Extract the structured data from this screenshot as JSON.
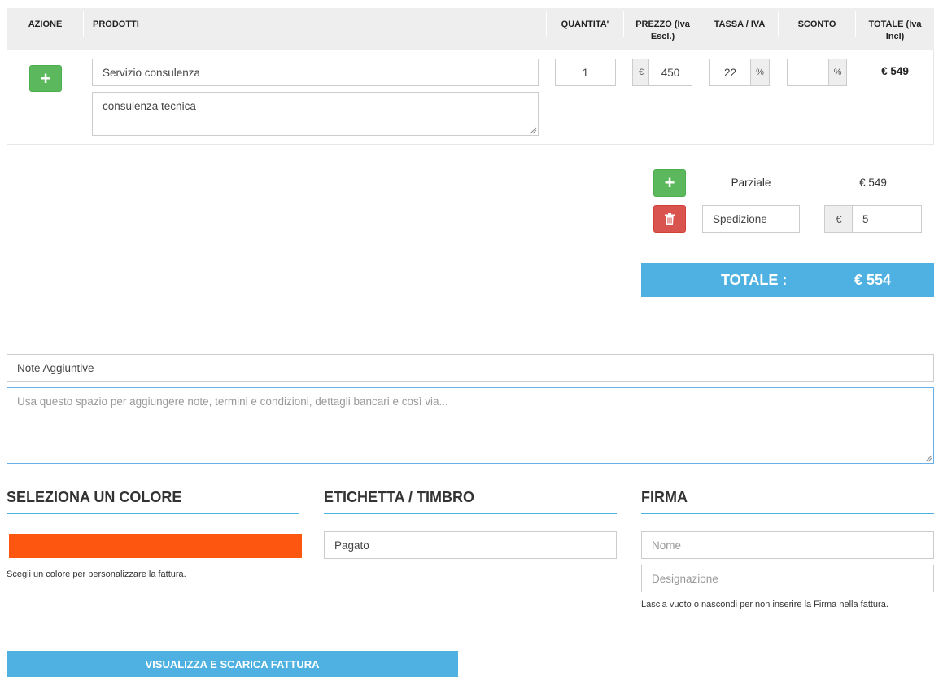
{
  "table": {
    "headers": {
      "azione": "AZIONE",
      "prodotti": "PRODOTTI",
      "quantita": "QUANTITA'",
      "prezzo_line1": "PREZZO (Iva",
      "prezzo_line2": "Escl.)",
      "tassa": "TASSA / IVA",
      "sconto": "SCONTO",
      "totale_line1": "TOTALE (Iva",
      "totale_line2": "Incl)"
    },
    "row": {
      "product_name": "Servizio consulenza",
      "description": "consulenza tecnica",
      "quantity": "1",
      "price_currency": "€",
      "price": "450",
      "tax": "22",
      "tax_unit": "%",
      "discount": "",
      "discount_unit": "%",
      "total": "€ 549"
    }
  },
  "summary": {
    "partial_label": "Parziale",
    "partial_value": "€ 549",
    "shipping_label": "Spedizione",
    "shipping_currency": "€",
    "shipping_value": "5",
    "total_label": "TOTALE :",
    "total_value": "€ 554"
  },
  "notes": {
    "title_value": "Note Aggiuntive",
    "placeholder": "Usa questo spazio per aggiungere note, termini e condizioni, dettagli bancari e così via..."
  },
  "color_section": {
    "title": "SELEZIONA UN COLORE",
    "color": "#fc5610",
    "help": "Scegli un colore per personalizzare la fattura."
  },
  "stamp_section": {
    "title": "ETICHETTA / TIMBRO",
    "value": "Pagato"
  },
  "signature_section": {
    "title": "FIRMA",
    "name_placeholder": "Nome",
    "designation_placeholder": "Designazione",
    "help": "Lascia vuoto o nascondi per non inserire la Firma nella fattura."
  },
  "actions": {
    "download_label": "VISUALIZZA E SCARICA FATTURA"
  },
  "icons": {
    "add_row": "plus-icon",
    "add_line": "plus-icon",
    "delete_line": "trash-icon"
  }
}
